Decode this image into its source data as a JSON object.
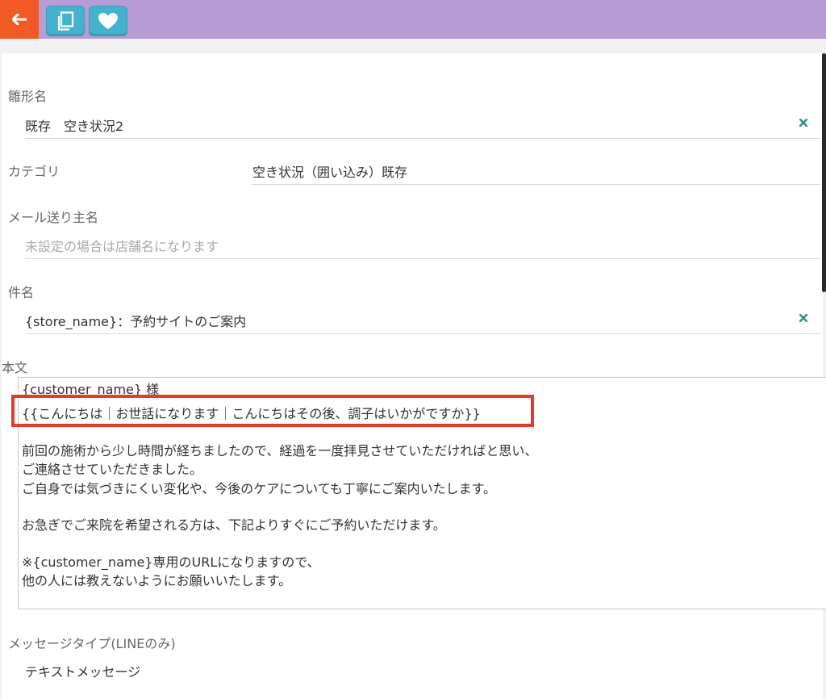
{
  "toolbar": {
    "back_icon": "arrow-left-icon",
    "copy_icon": "copy-icon",
    "favorite_icon": "heart-icon",
    "bar_color": "#b79bd4",
    "back_color": "#f15a24",
    "button_color": "#44b1ce"
  },
  "form": {
    "template_name": {
      "label": "雛形名",
      "value": "既存　空き状況2"
    },
    "category": {
      "label": "カテゴリ",
      "value": "空き状況（囲い込み）既存"
    },
    "sender_name": {
      "label": "メール送り主名",
      "placeholder": "未設定の場合は店舗名になります"
    },
    "subject": {
      "label": "件名",
      "value": "{store_name}：予約サイトのご案内"
    },
    "body": {
      "label": "本文",
      "lines": [
        "{customer_name} 様",
        "{{こんにちは｜お世話になります｜こんにちはその後、調子はいかがですか}}",
        "",
        "前回の施術から少し時間が経ちましたので、経過を一度拝見させていただければと思い、",
        "ご連絡させていただきました。",
        "ご自身では気づきにくい変化や、今後のケアについても丁寧にご案内いたします。",
        "",
        "お急ぎでご来院を希望される方は、下記よりすぐにご予約いただけます。",
        "",
        "※{customer_name}専用のURLになりますので、",
        "他の人には教えないようにお願いいたします。"
      ]
    },
    "message_type": {
      "label": "メッセージタイプ(LINEのみ)",
      "value": "テキストメッセージ"
    }
  }
}
